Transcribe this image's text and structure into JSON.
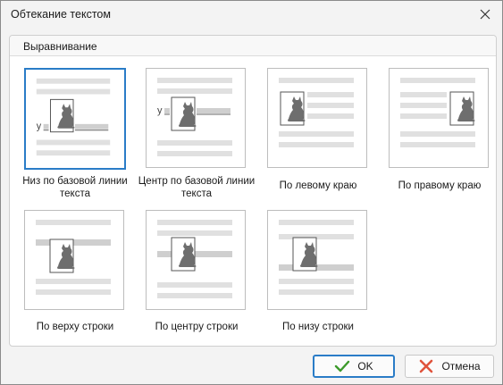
{
  "window": {
    "title": "Обтекание текстом"
  },
  "group": {
    "title": "Выравнивание"
  },
  "options": [
    {
      "label": "Низ по базовой линии текста",
      "variant": "baseline-bottom",
      "selected": true
    },
    {
      "label": "Центр по базовой линии текста",
      "variant": "baseline-center",
      "selected": false
    },
    {
      "label": "По левому краю",
      "variant": "left",
      "selected": false
    },
    {
      "label": "По правому краю",
      "variant": "right",
      "selected": false
    },
    {
      "label": "По верху строки",
      "variant": "line-top",
      "selected": false
    },
    {
      "label": "По центру строки",
      "variant": "line-center",
      "selected": false
    },
    {
      "label": "По низу строки",
      "variant": "line-bottom",
      "selected": false
    }
  ],
  "thumb_glyph": "y",
  "buttons": {
    "ok": "OK",
    "cancel": "Отмена"
  },
  "icons": {
    "close": "close-icon",
    "ok": "checkmark-icon",
    "cancel": "cross-icon",
    "picture": "cat-icon"
  },
  "colors": {
    "accent": "#2a7cc7",
    "ok_check": "#3c9a2b",
    "cancel_cross": "#e0533c",
    "text_bar": "#e0e0e0",
    "highlight_bar": "#cfcfcf",
    "cat": "#6e6e6e"
  }
}
